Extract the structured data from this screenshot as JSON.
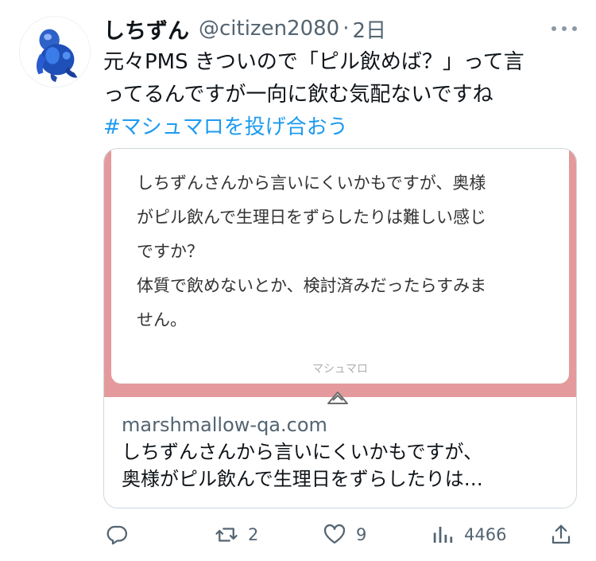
{
  "tweet": {
    "author_name": "しちずん",
    "handle": "@citizen2080",
    "separator": "·",
    "time": "2日",
    "text_lines": [
      "元々PMS きついので「ピル飲めば？」って言",
      "ってるんですが一向に飲む気配ないですね"
    ],
    "hashtag": "#マシュマロを投げ合おう"
  },
  "card": {
    "message_lines": [
      "しちずんさんから言いにくいかもですが、奥様",
      "がピル飲んで生理日をずらしたりは難しい感じ",
      "ですか？",
      "体質で飲めないとか、検討済みだったらすみま",
      "せん。"
    ],
    "brand": "マシュマロ",
    "domain": "marshmallow-qa.com",
    "description_lines": [
      "しちずんさんから言いにくいかもですが、",
      "奥様がピル飲んで生理日をずらしたりは…"
    ],
    "image_bg_color": "#e49a9c"
  },
  "actions": {
    "reply": {
      "icon": "reply-icon",
      "count": ""
    },
    "retweet": {
      "icon": "retweet-icon",
      "count": "2"
    },
    "like": {
      "icon": "heart-icon",
      "count": "9"
    },
    "views": {
      "icon": "views-icon",
      "count": "4466"
    },
    "share": {
      "icon": "share-icon"
    }
  },
  "colors": {
    "hashtag": "#1d9bf0",
    "secondary_text": "#536471",
    "card_accent": "#e49a9c"
  }
}
